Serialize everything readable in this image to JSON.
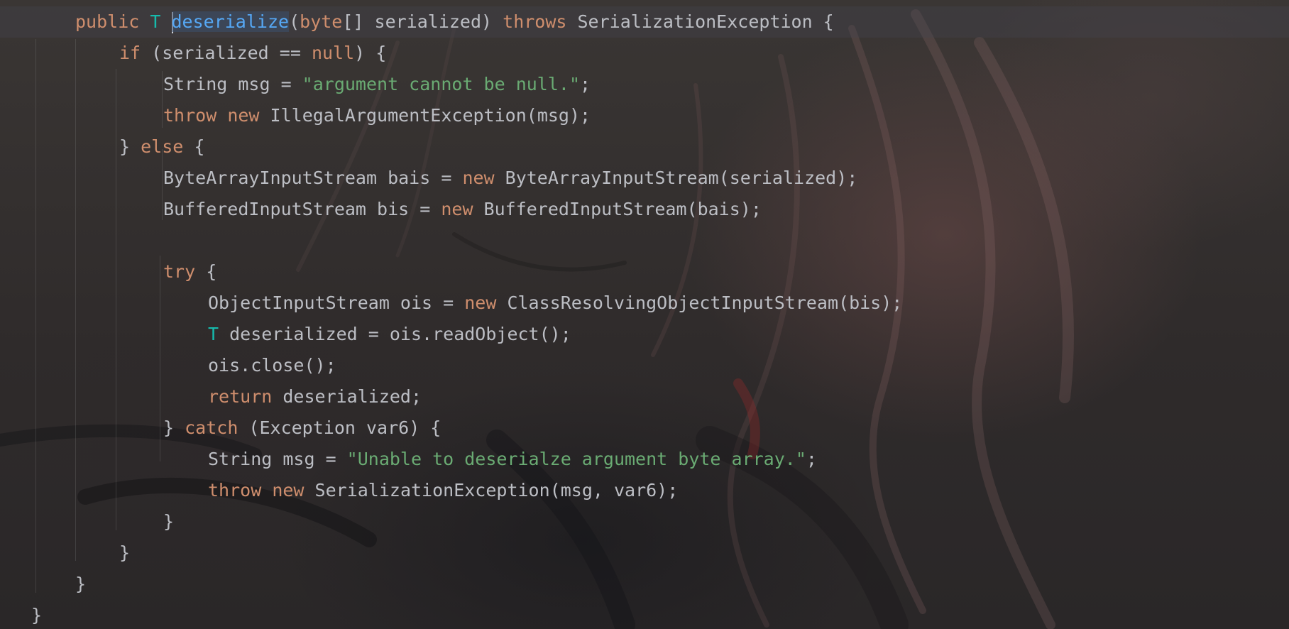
{
  "editor": {
    "language": "java",
    "theme_colors": {
      "keyword": "#cf8e6d",
      "type_parameter": "#16baac",
      "string": "#6aab73",
      "method_declaration": "#56a8f5",
      "default": "#bcbec4"
    },
    "lines": [
      {
        "indent": 2,
        "tokens": [
          {
            "t": "kw",
            "v": "public"
          },
          {
            "t": "plain",
            "v": " "
          },
          {
            "t": "tparam",
            "v": "T"
          },
          {
            "t": "plain",
            "v": " "
          },
          {
            "t": "caret",
            "v": ""
          },
          {
            "t": "method-hl",
            "v": "deserialize"
          },
          {
            "t": "plain",
            "v": "("
          },
          {
            "t": "kw",
            "v": "byte"
          },
          {
            "t": "plain",
            "v": "[] serialized) "
          },
          {
            "t": "kw",
            "v": "throws"
          },
          {
            "t": "plain",
            "v": " SerializationException {"
          }
        ]
      },
      {
        "indent": 3,
        "tokens": [
          {
            "t": "kw",
            "v": "if"
          },
          {
            "t": "plain",
            "v": " (serialized == "
          },
          {
            "t": "kw",
            "v": "null"
          },
          {
            "t": "plain",
            "v": ") {"
          }
        ]
      },
      {
        "indent": 4,
        "tokens": [
          {
            "t": "plain",
            "v": "String msg = "
          },
          {
            "t": "str",
            "v": "\"argument cannot be null.\""
          },
          {
            "t": "plain",
            "v": ";"
          }
        ]
      },
      {
        "indent": 4,
        "tokens": [
          {
            "t": "kw",
            "v": "throw"
          },
          {
            "t": "plain",
            "v": " "
          },
          {
            "t": "kw",
            "v": "new"
          },
          {
            "t": "plain",
            "v": " IllegalArgumentException(msg);"
          }
        ]
      },
      {
        "indent": 3,
        "tokens": [
          {
            "t": "plain",
            "v": "} "
          },
          {
            "t": "kw",
            "v": "else"
          },
          {
            "t": "plain",
            "v": " {"
          }
        ]
      },
      {
        "indent": 4,
        "tokens": [
          {
            "t": "plain",
            "v": "ByteArrayInputStream bais = "
          },
          {
            "t": "kw",
            "v": "new"
          },
          {
            "t": "plain",
            "v": " ByteArrayInputStream(serialized);"
          }
        ]
      },
      {
        "indent": 4,
        "tokens": [
          {
            "t": "plain",
            "v": "BufferedInputStream bis = "
          },
          {
            "t": "kw",
            "v": "new"
          },
          {
            "t": "plain",
            "v": " BufferedInputStream(bais);"
          }
        ]
      },
      {
        "indent": 0,
        "tokens": []
      },
      {
        "indent": 4,
        "tokens": [
          {
            "t": "kw",
            "v": "try"
          },
          {
            "t": "plain",
            "v": " {"
          }
        ]
      },
      {
        "indent": 5,
        "tokens": [
          {
            "t": "plain",
            "v": "ObjectInputStream ois = "
          },
          {
            "t": "kw",
            "v": "new"
          },
          {
            "t": "plain",
            "v": " ClassResolvingObjectInputStream(bis);"
          }
        ]
      },
      {
        "indent": 5,
        "tokens": [
          {
            "t": "tparam",
            "v": "T"
          },
          {
            "t": "plain",
            "v": " deserialized = ois.readObject();"
          }
        ]
      },
      {
        "indent": 5,
        "tokens": [
          {
            "t": "plain",
            "v": "ois.close();"
          }
        ]
      },
      {
        "indent": 5,
        "tokens": [
          {
            "t": "kw",
            "v": "return"
          },
          {
            "t": "plain",
            "v": " deserialized;"
          }
        ]
      },
      {
        "indent": 4,
        "tokens": [
          {
            "t": "plain",
            "v": "} "
          },
          {
            "t": "kw",
            "v": "catch"
          },
          {
            "t": "plain",
            "v": " (Exception var6) {"
          }
        ]
      },
      {
        "indent": 5,
        "tokens": [
          {
            "t": "plain",
            "v": "String msg = "
          },
          {
            "t": "str",
            "v": "\"Unable to deserialze argument byte array.\""
          },
          {
            "t": "plain",
            "v": ";"
          }
        ]
      },
      {
        "indent": 5,
        "tokens": [
          {
            "t": "kw",
            "v": "throw"
          },
          {
            "t": "plain",
            "v": " "
          },
          {
            "t": "kw",
            "v": "new"
          },
          {
            "t": "plain",
            "v": " SerializationException(msg, var6);"
          }
        ]
      },
      {
        "indent": 4,
        "tokens": [
          {
            "t": "plain",
            "v": "}"
          }
        ]
      },
      {
        "indent": 3,
        "tokens": [
          {
            "t": "plain",
            "v": "}"
          }
        ]
      },
      {
        "indent": 2,
        "tokens": [
          {
            "t": "plain",
            "v": "}"
          }
        ]
      },
      {
        "indent": 1,
        "tokens": [
          {
            "t": "plain",
            "v": "}"
          }
        ]
      }
    ]
  }
}
